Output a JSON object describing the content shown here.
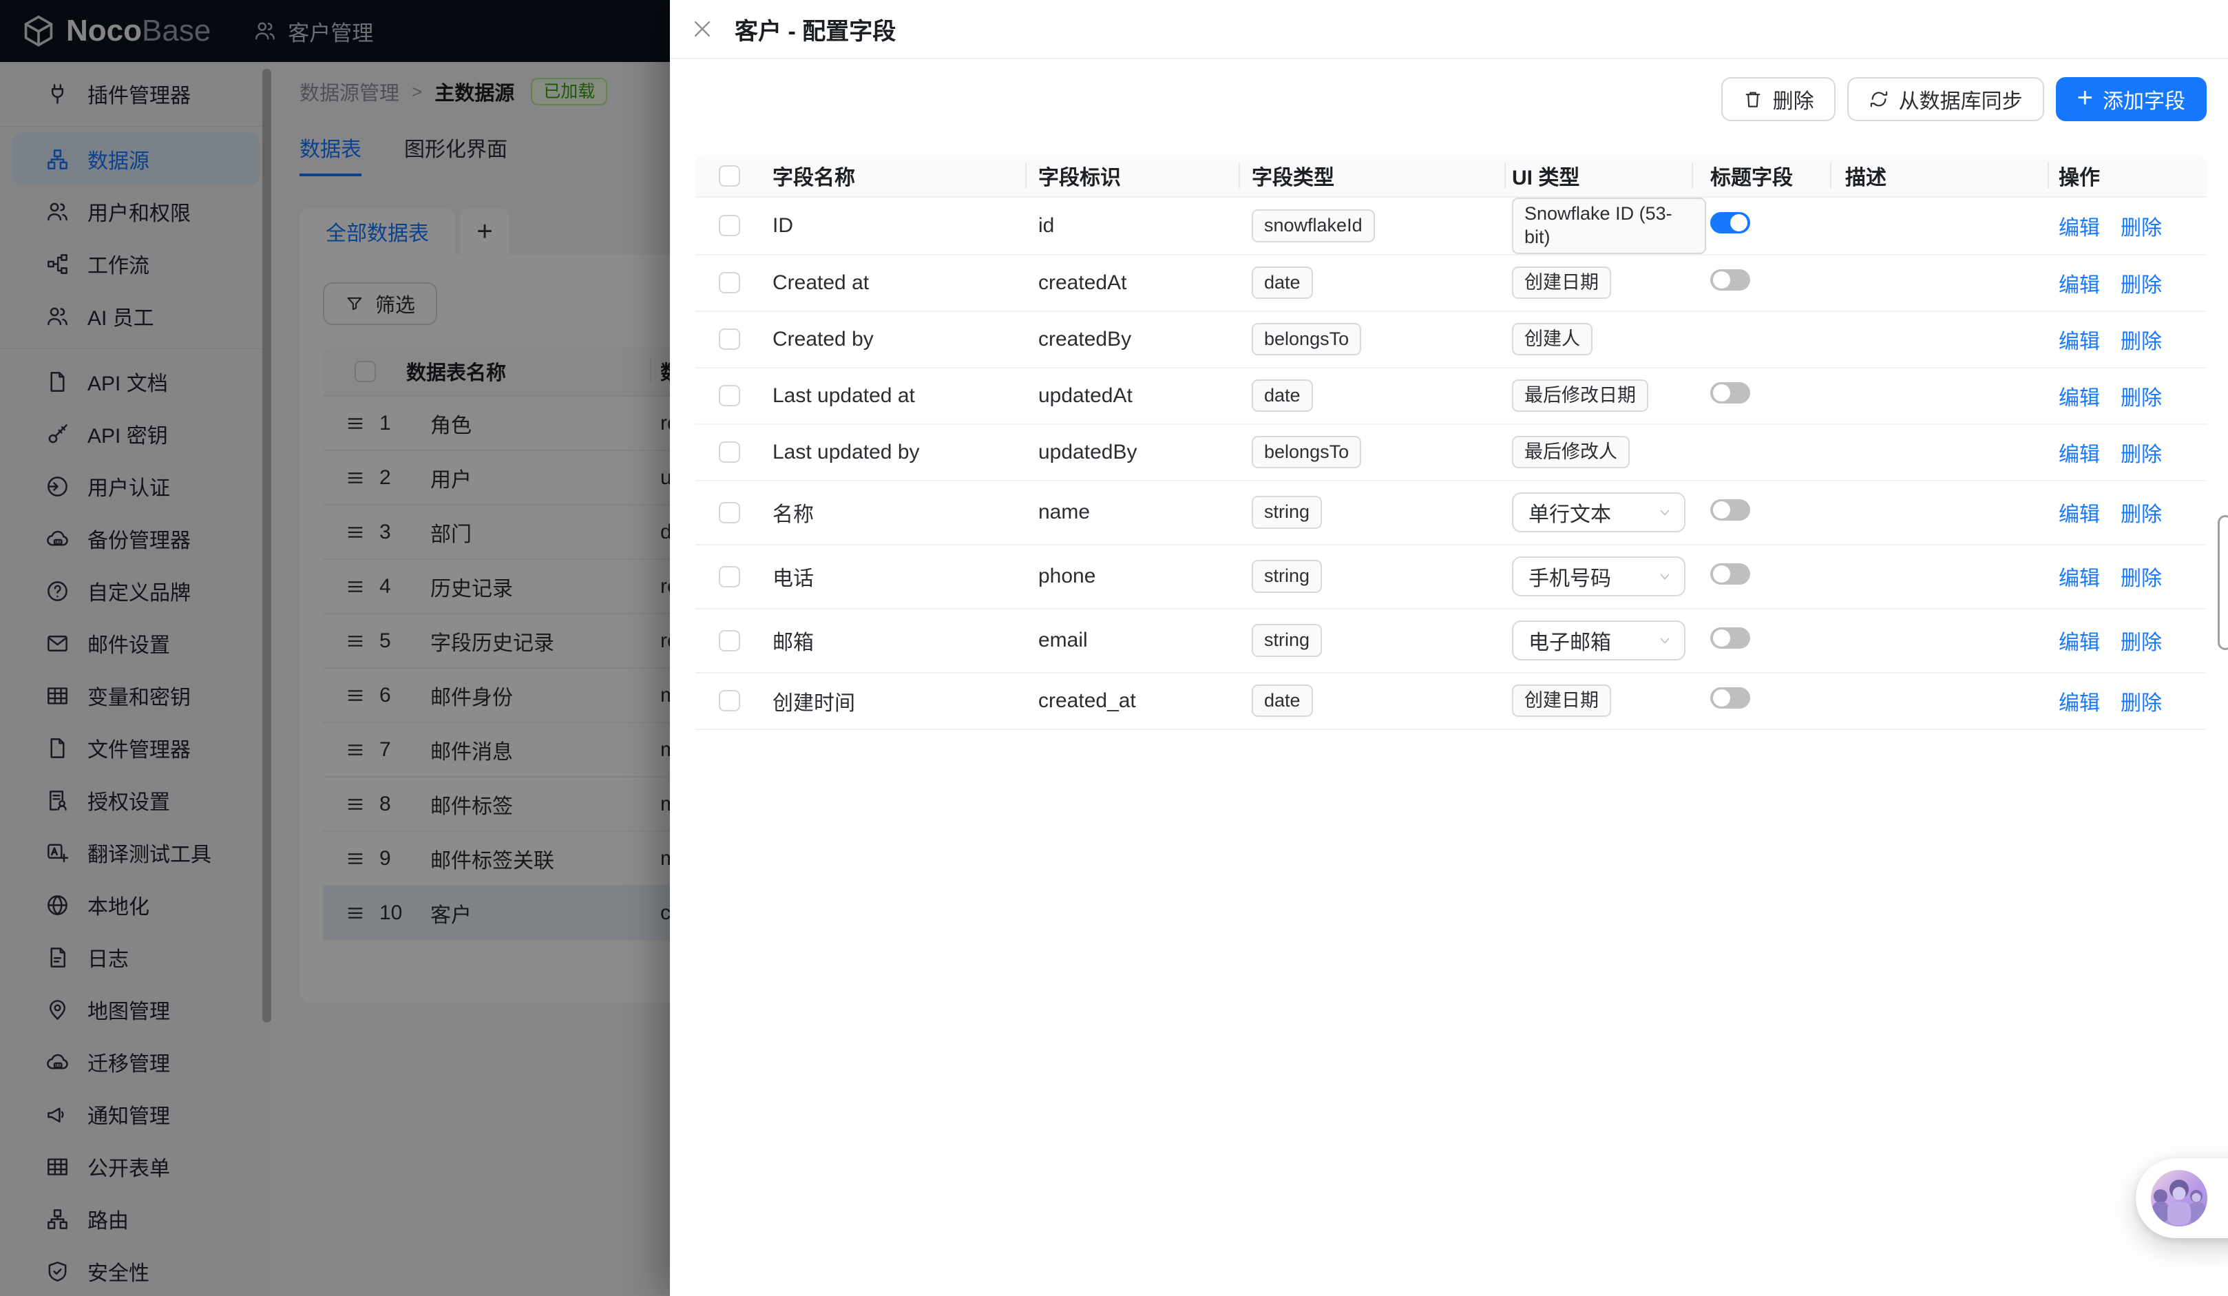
{
  "topbar": {
    "logo": {
      "noco": "Noco",
      "base": "Base"
    },
    "app_title": "客户管理"
  },
  "sidebar": {
    "items": [
      {
        "label": "插件管理器",
        "icon": "plug-icon",
        "active": false
      },
      {
        "label": "数据源",
        "icon": "datasource-icon",
        "active": true
      },
      {
        "label": "用户和权限",
        "icon": "users-icon",
        "active": false
      },
      {
        "label": "工作流",
        "icon": "workflow-icon",
        "active": false
      },
      {
        "label": "AI 员工",
        "icon": "ai-employees-icon",
        "active": false
      },
      {
        "label": "API 文档",
        "icon": "api-doc-icon",
        "active": false
      },
      {
        "label": "API 密钥",
        "icon": "api-key-icon",
        "active": false
      },
      {
        "label": "用户认证",
        "icon": "authentication-icon",
        "active": false
      },
      {
        "label": "备份管理器",
        "icon": "backup-cloud-icon",
        "active": false
      },
      {
        "label": "自定义品牌",
        "icon": "custom-brand-icon",
        "active": false
      },
      {
        "label": "邮件设置",
        "icon": "mail-settings-icon",
        "active": false
      },
      {
        "label": "变量和密钥",
        "icon": "variables-icon",
        "active": false
      },
      {
        "label": "文件管理器",
        "icon": "file-manager-icon",
        "active": false
      },
      {
        "label": "授权设置",
        "icon": "license-icon",
        "active": false
      },
      {
        "label": "翻译测试工具",
        "icon": "translate-icon",
        "active": false
      },
      {
        "label": "本地化",
        "icon": "localization-icon",
        "active": false
      },
      {
        "label": "日志",
        "icon": "logs-icon",
        "active": false
      },
      {
        "label": "地图管理",
        "icon": "map-icon",
        "active": false
      },
      {
        "label": "迁移管理",
        "icon": "migration-cloud-icon",
        "active": false
      },
      {
        "label": "通知管理",
        "icon": "notification-icon",
        "active": false
      },
      {
        "label": "公开表单",
        "icon": "public-form-icon",
        "active": false
      },
      {
        "label": "路由",
        "icon": "routes-icon",
        "active": false
      },
      {
        "label": "安全性",
        "icon": "security-icon",
        "active": false
      }
    ]
  },
  "page": {
    "breadcrumb": {
      "root": "数据源管理",
      "separator": ">",
      "current": "主数据源",
      "badge": "已加载"
    },
    "tabs": [
      {
        "label": "数据表",
        "active": true
      },
      {
        "label": "图形化界面",
        "active": false
      }
    ],
    "collection_tab": "全部数据表",
    "add_tab_label": "+",
    "filter_label": "筛选",
    "table": {
      "header_name": "数据表名称",
      "header_key_partial": "数",
      "rows": [
        {
          "no": "1",
          "name": "角色",
          "key_partial": "ro",
          "selected": false
        },
        {
          "no": "2",
          "name": "用户",
          "key_partial": "u",
          "selected": false
        },
        {
          "no": "3",
          "name": "部门",
          "key_partial": "d",
          "selected": false
        },
        {
          "no": "4",
          "name": "历史记录",
          "key_partial": "re",
          "selected": false
        },
        {
          "no": "5",
          "name": "字段历史记录",
          "key_partial": "re",
          "selected": false
        },
        {
          "no": "6",
          "name": "邮件身份",
          "key_partial": "m",
          "selected": false
        },
        {
          "no": "7",
          "name": "邮件消息",
          "key_partial": "m",
          "selected": false
        },
        {
          "no": "8",
          "name": "邮件标签",
          "key_partial": "m",
          "selected": false
        },
        {
          "no": "9",
          "name": "邮件标签关联",
          "key_partial": "m",
          "selected": false
        },
        {
          "no": "10",
          "name": "客户",
          "key_partial": "c",
          "selected": true
        }
      ]
    }
  },
  "drawer": {
    "title": "客户 - 配置字段",
    "toolbar": {
      "delete": "删除",
      "sync": "从数据库同步",
      "add": "添加字段"
    },
    "table": {
      "headers": [
        "字段名称",
        "字段标识",
        "字段类型",
        "UI 类型",
        "标题字段",
        "描述",
        "操作"
      ],
      "actions": {
        "edit": "编辑",
        "delete": "删除"
      },
      "rows": [
        {
          "name": "ID",
          "key": "id",
          "type": "snowflakeId",
          "ui": "Snowflake ID (53-bit)",
          "ui_widget": "tag",
          "title_toggle": "on",
          "description": ""
        },
        {
          "name": "Created at",
          "key": "createdAt",
          "type": "date",
          "ui": "创建日期",
          "ui_widget": "tag",
          "title_toggle": "off",
          "description": ""
        },
        {
          "name": "Created by",
          "key": "createdBy",
          "type": "belongsTo",
          "ui": "创建人",
          "ui_widget": "tag",
          "title_toggle": null,
          "description": ""
        },
        {
          "name": "Last updated at",
          "key": "updatedAt",
          "type": "date",
          "ui": "最后修改日期",
          "ui_widget": "tag",
          "title_toggle": "off",
          "description": ""
        },
        {
          "name": "Last updated by",
          "key": "updatedBy",
          "type": "belongsTo",
          "ui": "最后修改人",
          "ui_widget": "tag",
          "title_toggle": null,
          "description": ""
        },
        {
          "name": "名称",
          "key": "name",
          "type": "string",
          "ui": "单行文本",
          "ui_widget": "select",
          "title_toggle": "off",
          "description": ""
        },
        {
          "name": "电话",
          "key": "phone",
          "type": "string",
          "ui": "手机号码",
          "ui_widget": "select",
          "title_toggle": "off",
          "description": ""
        },
        {
          "name": "邮箱",
          "key": "email",
          "type": "string",
          "ui": "电子邮箱",
          "ui_widget": "select",
          "title_toggle": "off",
          "description": ""
        },
        {
          "name": "创建时间",
          "key": "created_at",
          "type": "date",
          "ui": "创建日期",
          "ui_widget": "tag",
          "title_toggle": "off",
          "description": ""
        }
      ]
    }
  },
  "colors": {
    "accent": "#1677ff",
    "badge_green_text": "#389e0d",
    "badge_green_bg": "#f6ffed",
    "badge_green_border": "#b7eb8f",
    "toggle_off": "#bfbfbf",
    "topbar_bg": "#0d1220"
  }
}
